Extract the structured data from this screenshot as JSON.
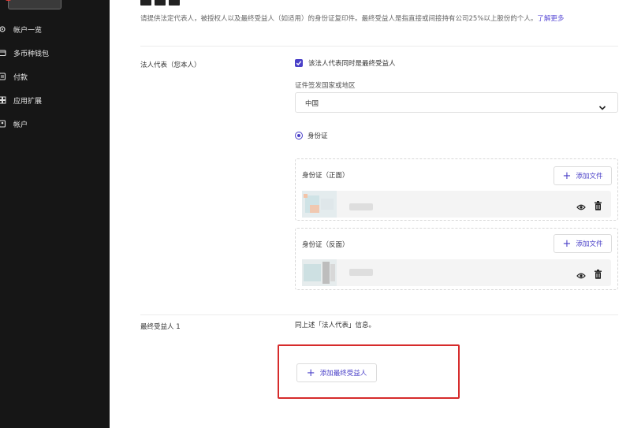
{
  "sidebar": {
    "items": [
      {
        "label": "帐户一览",
        "icon": "gear-icon"
      },
      {
        "label": "多币种钱包",
        "icon": "wallet-icon"
      },
      {
        "label": "付款",
        "icon": "payment-icon"
      },
      {
        "label": "应用扩展",
        "icon": "extension-icon"
      },
      {
        "label": "帐户",
        "icon": "account-icon"
      }
    ]
  },
  "intro": {
    "text": "请提供法定代表人，被授权人以及最终受益人（如适用）的身份证复印件。最终受益人是指直接或间接持有公司25%以上股份的个人。",
    "link": "了解更多"
  },
  "legal_rep": {
    "label": "法人代表（您本人）",
    "checkbox_label": "该法人代表同时是最终受益人",
    "checked": true,
    "country_label": "证件签发国家或地区",
    "country_value": "中国",
    "id_type_label": "身份证",
    "front": {
      "title": "身份证（正面）",
      "add_label": "添加文件"
    },
    "back": {
      "title": "身份证（反面）",
      "add_label": "添加文件"
    }
  },
  "beneficiary": {
    "label": "最终受益人 1",
    "note": "同上述「法人代表」信息。",
    "add_label": "添加最终受益人"
  },
  "colors": {
    "accent": "#4a40c8",
    "sidebar_bg": "#161616",
    "highlight": "#d62b2b"
  }
}
